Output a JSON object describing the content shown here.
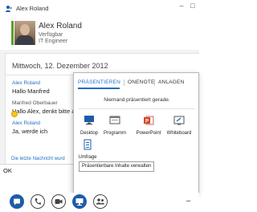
{
  "window": {
    "title": "Alex Roland",
    "minimize_glyph": "–",
    "maximize_glyph": "□"
  },
  "contact": {
    "name": "Alex Roland",
    "status": "Verfügbar",
    "role": "IT Engineer",
    "presence_color": "#5ea02e"
  },
  "conversation": {
    "date": "Mittwoch, 12. Dezember 2012",
    "messages": [
      {
        "sender": "Alex Roland",
        "text": "Hallo Manfred"
      },
      {
        "sender": "Manfred Oberbauer",
        "text": "Hallo Alex, denkt bitte a"
      },
      {
        "sender": "Alex Roland",
        "text": "Ja, werde ich"
      }
    ],
    "last_message_link": "Die letzte Nachricht wurd"
  },
  "input": {
    "value": "OK"
  },
  "present_popup": {
    "tabs": [
      "PRÄSENTIEREN",
      "ONENOTE",
      "ANLAGEN"
    ],
    "active_tab": "PRÄSENTIEREN",
    "nobody_presenting": "Niemand präsentiert gerade.",
    "items": [
      {
        "label": "Desktop",
        "icon": "desktop-icon"
      },
      {
        "label": "Programm",
        "icon": "program-icon"
      },
      {
        "label": "PowerPoint",
        "icon": "powerpoint-icon"
      },
      {
        "label": "Whiteboard",
        "icon": "whiteboard-icon"
      },
      {
        "label": "Umfrage",
        "icon": "poll-icon"
      }
    ],
    "manage_button": "Präsentierbare Inhalte verwalten"
  },
  "bottom_bar": {
    "buttons": [
      "im-icon",
      "phone-icon",
      "video-icon",
      "present-icon",
      "participants-icon"
    ],
    "accent_color": "#1e5ca8",
    "more_glyph": "•••"
  }
}
